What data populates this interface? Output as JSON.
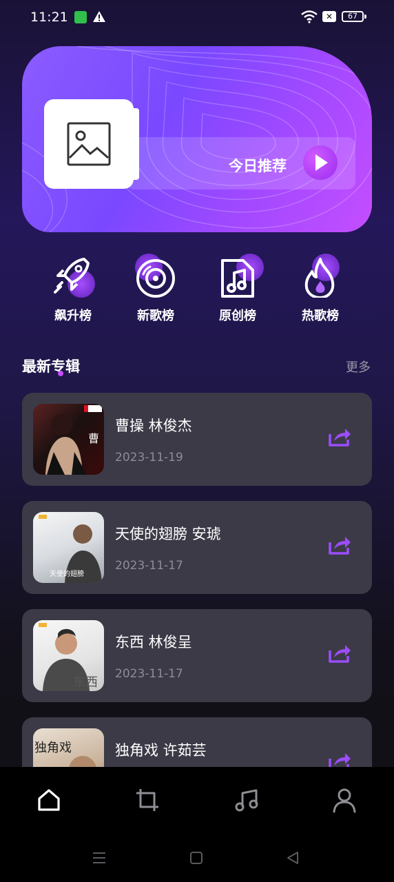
{
  "status_bar": {
    "time": "11:21",
    "icons": [
      "sim-icon",
      "warning-icon",
      "wifi-icon",
      "close-box-icon",
      "battery-icon"
    ],
    "battery_level": "67"
  },
  "hero": {
    "recommend_label": "今日推荐",
    "accent_color": "#9b4dff"
  },
  "categories": [
    {
      "label": "飙升榜",
      "icon": "rocket-icon"
    },
    {
      "label": "新歌榜",
      "icon": "vinyl-disc-icon"
    },
    {
      "label": "原创榜",
      "icon": "music-file-icon"
    },
    {
      "label": "热歌榜",
      "icon": "flame-icon"
    }
  ],
  "section": {
    "title": "最新专辑",
    "more": "更多"
  },
  "albums": [
    {
      "name": "曹操 林俊杰",
      "date": "2023-11-19"
    },
    {
      "name": "天使的翅膀 安琥",
      "date": "2023-11-17",
      "thumb_caption": "天使的翅膀"
    },
    {
      "name": "东西 林俊呈",
      "date": "2023-11-17",
      "thumb_caption": "东西"
    },
    {
      "name": "独角戏 许茹芸",
      "date": "",
      "thumb_caption": "独角戏"
    }
  ],
  "tabbar": {
    "tabs": [
      "home-icon",
      "crop-icon",
      "music-note-icon",
      "profile-icon"
    ]
  },
  "system_nav": [
    "menu-icon",
    "home-square-icon",
    "back-triangle-icon"
  ]
}
